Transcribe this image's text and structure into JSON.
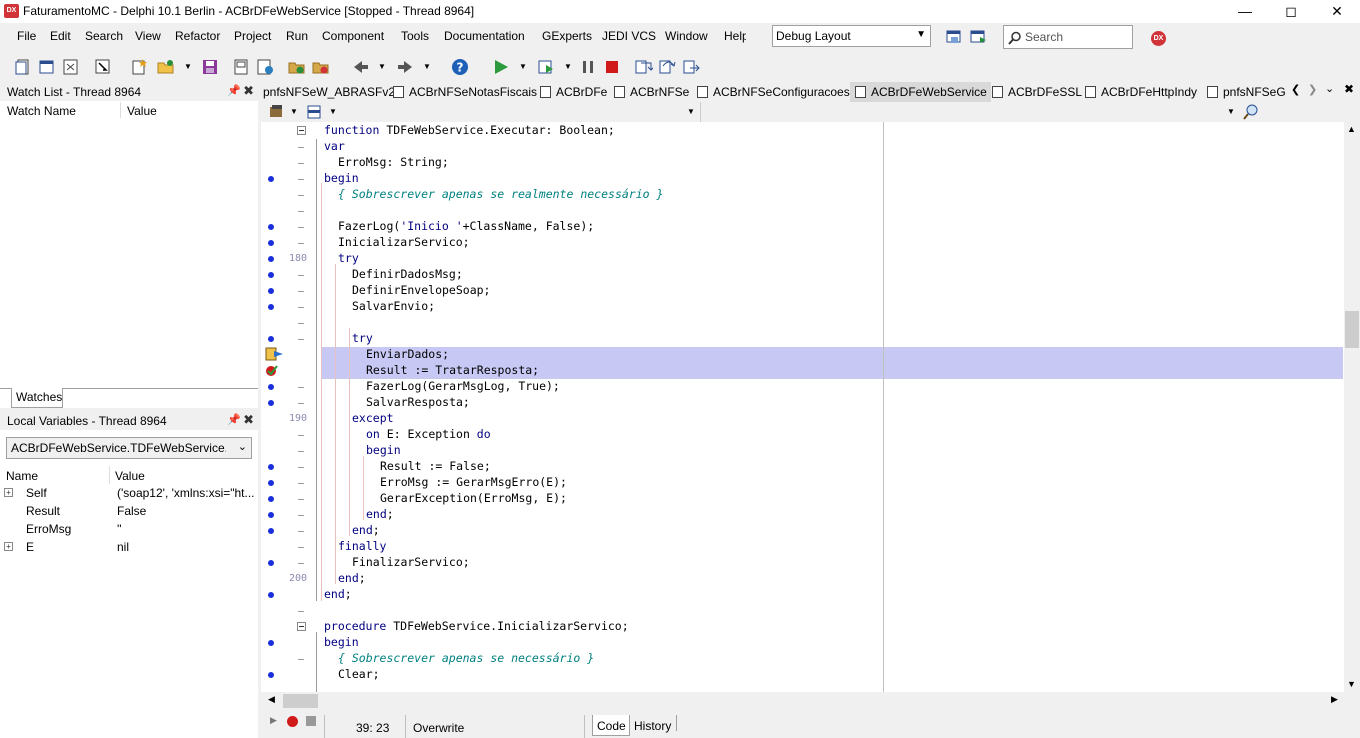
{
  "window": {
    "logo_text": "DX",
    "title": "FaturamentoMC - Delphi 10.1 Berlin - ACBrDFeWebService [Stopped - Thread 8964]",
    "min_icon": "minimize-icon",
    "max_icon": "maximize-icon",
    "close_icon": "close-icon"
  },
  "menu": {
    "items": [
      "File",
      "Edit",
      "Search",
      "View",
      "Refactor",
      "Project",
      "Run",
      "Component",
      "Tools",
      "Documentation",
      "GExperts",
      "JEDI VCS",
      "Window",
      "Help"
    ],
    "layout_value": "Debug Layout",
    "search_placeholder": "Search",
    "dx_label": "DX"
  },
  "watch_panel": {
    "title": "Watch List - Thread 8964",
    "col_name": "Watch Name",
    "col_value": "Value",
    "tab_label": "Watches"
  },
  "locals_panel": {
    "title": "Local Variables - Thread 8964",
    "selector_value": "ACBrDFeWebService.TDFeWebService.Executar",
    "col_name": "Name",
    "col_value": "Value",
    "rows": [
      {
        "name": "Self",
        "value": "('soap12', 'xmlns:xsi=\"ht...",
        "expandable": true
      },
      {
        "name": "Result",
        "value": "False",
        "expandable": false
      },
      {
        "name": "ErroMsg",
        "value": "''",
        "expandable": false
      },
      {
        "name": "E",
        "value": "nil",
        "expandable": true
      }
    ]
  },
  "editor_tabs": [
    "pnfsNFSeW_ABRASFv2",
    "ACBrNFSeNotasFiscais",
    "ACBrDFe",
    "ACBrNFSe",
    "ACBrNFSeConfiguracoes",
    "ACBrDFeWebService",
    "ACBrDFeSSL",
    "ACBrDFeHttpIndy",
    "pnfsNFSeG"
  ],
  "active_tab": "ACBrDFeWebService",
  "line_numbers": {
    "l180": "180",
    "l190": "190",
    "l200": "200"
  },
  "status": {
    "position": "39: 23",
    "mode": "Overwrite",
    "tab_code": "Code",
    "tab_history": "History"
  }
}
